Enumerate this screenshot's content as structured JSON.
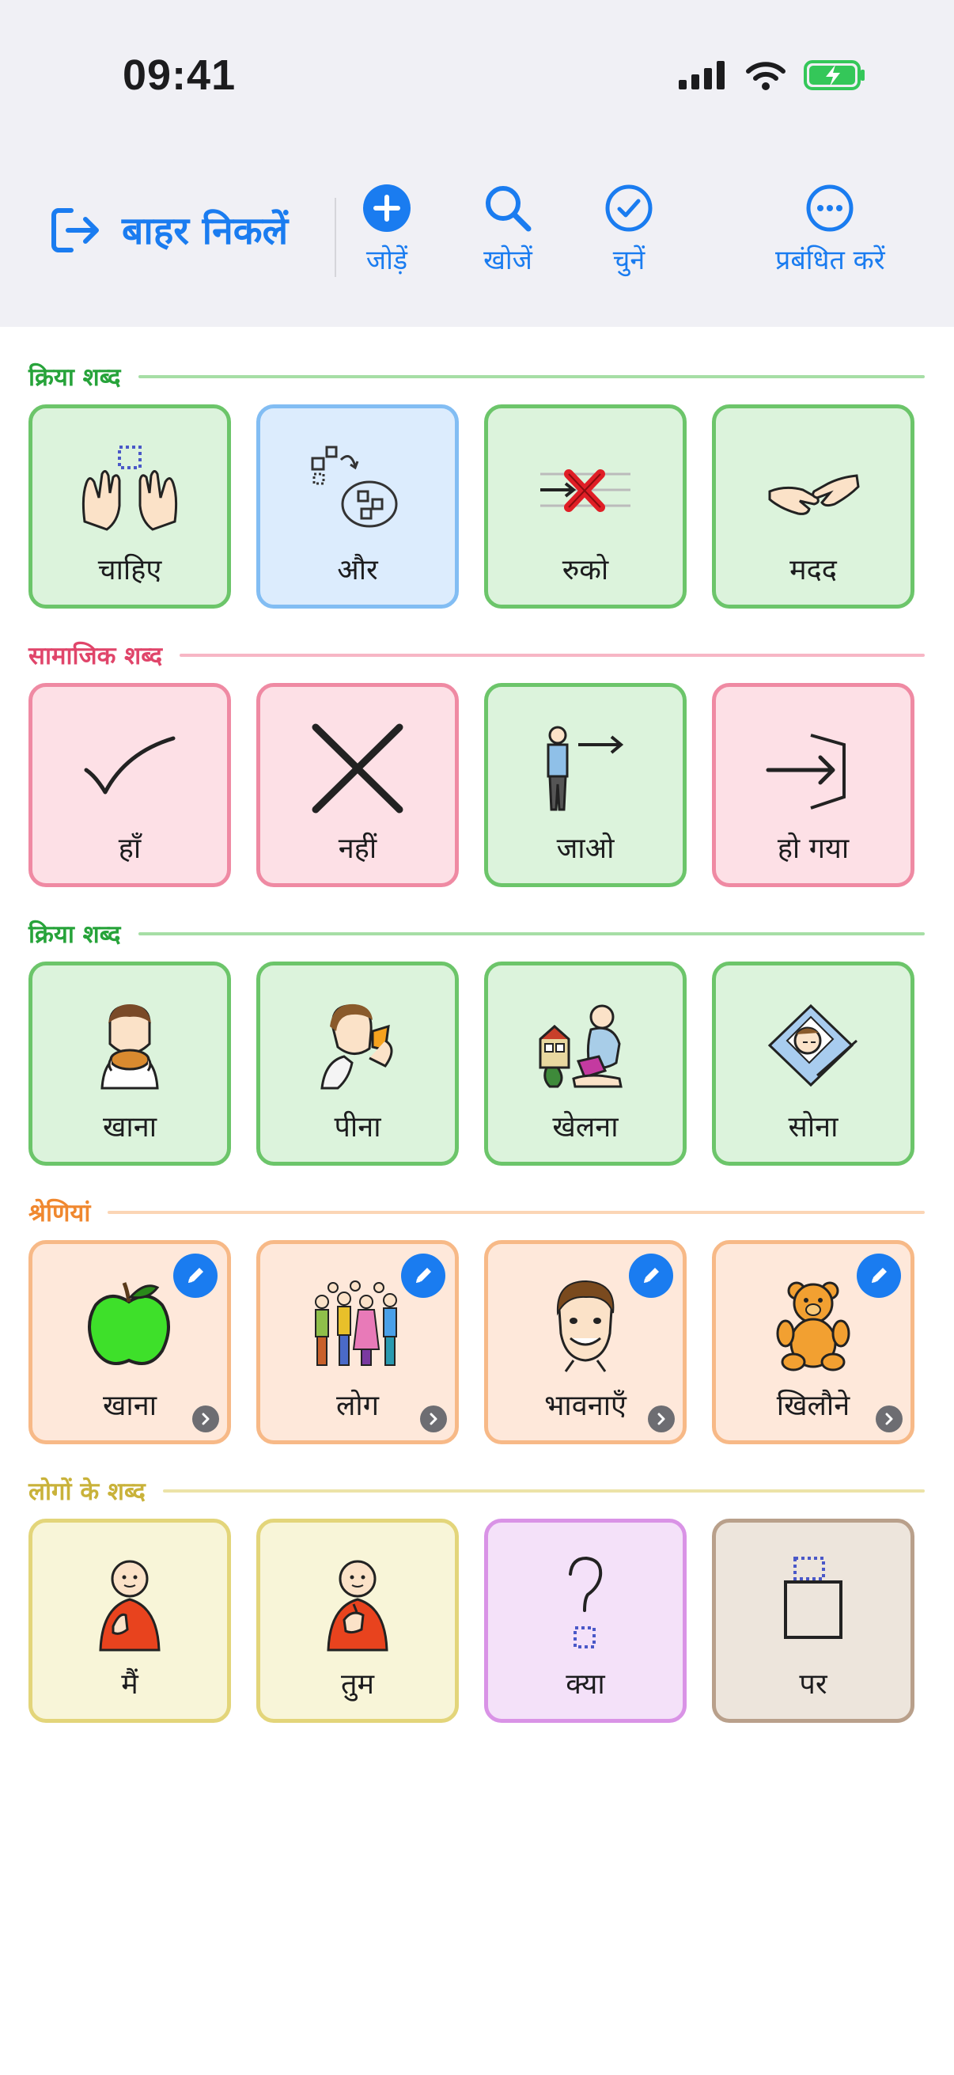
{
  "status_bar": {
    "time": "09:41"
  },
  "toolbar": {
    "exit_label": "बाहर निकलें",
    "add_label": "जोड़ें",
    "search_label": "खोजें",
    "select_label": "चुनें",
    "manage_label": "प्रबंधित करें"
  },
  "sections": [
    {
      "title": "क्रिया शब्द",
      "color": "#27a33a",
      "line_color": "#a6dea5",
      "tiles": [
        {
          "label": "चाहिए",
          "icon": "want-hands-icon",
          "color": "green"
        },
        {
          "label": "और",
          "icon": "more-icon",
          "color": "blue"
        },
        {
          "label": "रुको",
          "icon": "stop-icon",
          "color": "green"
        },
        {
          "label": "मदद",
          "icon": "help-icon",
          "color": "green"
        }
      ]
    },
    {
      "title": "सामाजिक शब्द",
      "color": "#e0456a",
      "line_color": "#f7b6c5",
      "tiles": [
        {
          "label": "हाँ",
          "icon": "checkmark-icon",
          "color": "pink"
        },
        {
          "label": "नहीं",
          "icon": "cross-icon",
          "color": "pink"
        },
        {
          "label": "जाओ",
          "icon": "go-icon",
          "color": "green"
        },
        {
          "label": "हो गया",
          "icon": "finished-icon",
          "color": "pink"
        }
      ]
    },
    {
      "title": "क्रिया शब्द",
      "color": "#27a33a",
      "line_color": "#a6dea5",
      "tiles": [
        {
          "label": "खाना",
          "icon": "eat-icon",
          "color": "green"
        },
        {
          "label": "पीना",
          "icon": "drink-icon",
          "color": "green"
        },
        {
          "label": "खेलना",
          "icon": "play-icon",
          "color": "green"
        },
        {
          "label": "सोना",
          "icon": "sleep-icon",
          "color": "green"
        }
      ]
    },
    {
      "title": "श्रेणियां",
      "color": "#f0882f",
      "line_color": "#fbd5b5",
      "tiles": [
        {
          "label": "खाना",
          "icon": "apple-icon",
          "color": "orange",
          "editable": true
        },
        {
          "label": "लोग",
          "icon": "people-icon",
          "color": "orange",
          "editable": true
        },
        {
          "label": "भावनाएँ",
          "icon": "face-icon",
          "color": "orange",
          "editable": true
        },
        {
          "label": "खिलौने",
          "icon": "teddy-bear-icon",
          "color": "orange",
          "editable": true
        }
      ]
    },
    {
      "title": "लोगों के शब्द",
      "color": "#c9b23a",
      "line_color": "#ece3a8",
      "tiles": [
        {
          "label": "मैं",
          "icon": "me-icon",
          "color": "yellow"
        },
        {
          "label": "तुम",
          "icon": "you-icon",
          "color": "yellow"
        },
        {
          "label": "क्या",
          "icon": "question-icon",
          "color": "purple"
        },
        {
          "label": "पर",
          "icon": "on-icon",
          "color": "tan"
        }
      ]
    }
  ]
}
